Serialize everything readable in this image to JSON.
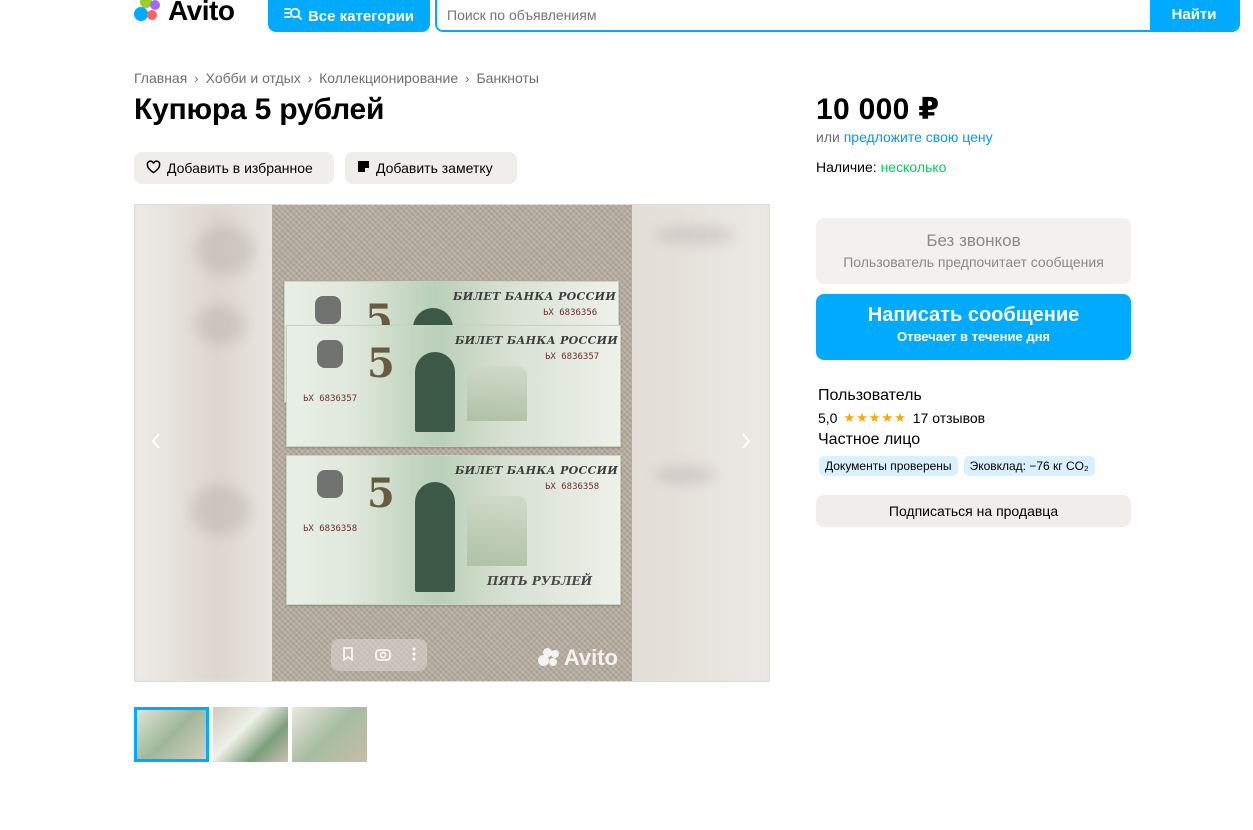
{
  "header": {
    "logo_text": "Avito",
    "categories_label": "Все категории",
    "search_placeholder": "Поиск по объявлениям",
    "search_button": "Найти"
  },
  "breadcrumbs": [
    "Главная",
    "Хобби и отдых",
    "Коллекционирование",
    "Банкноты"
  ],
  "listing": {
    "title": "Купюра 5 рублей",
    "favorite_label": "Добавить в избранное",
    "note_label": "Добавить заметку"
  },
  "gallery": {
    "banknote_bank": "БИЛЕТ БАНКА РОССИИ",
    "banknote_denomination": "5",
    "banknote_words": "ПЯТЬ РУБЛЕЙ",
    "serials": [
      "ЬХ 6836356",
      "ЬХ 6836357",
      "ЬХ 6836358"
    ],
    "watermark": "Avito",
    "thumbnail_count": 3,
    "active_thumbnail": 1
  },
  "sidebar": {
    "price": "10 000 ₽",
    "offer_prefix": "или",
    "offer_link": "предложите свою цену",
    "availability_label": "Наличие:",
    "availability_value": "несколько",
    "no_calls_title": "Без звонков",
    "no_calls_sub": "Пользователь предпочитает сообщения",
    "message_button": "Написать сообщение",
    "message_sub": "Отвечает в течение дня",
    "seller_type": "Пользователь",
    "rating_value": "5,0",
    "stars": "★★★★★",
    "reviews": "17 отзывов",
    "seller_kind": "Частное лицо",
    "badge_docs": "Документы проверены",
    "badge_eco": "Эковклад: −76 кг CO₂",
    "subscribe_button": "Подписаться на продавца"
  },
  "colors": {
    "accent": "#00aaff",
    "available_green": "#02d15c",
    "star": "#ffa400",
    "link": "#0099f7"
  },
  "icons": [
    "search-categories-icon",
    "heart-icon",
    "note-icon",
    "chevron-left-icon",
    "chevron-right-icon",
    "bookmark-icon",
    "lens-icon",
    "more-icon"
  ]
}
